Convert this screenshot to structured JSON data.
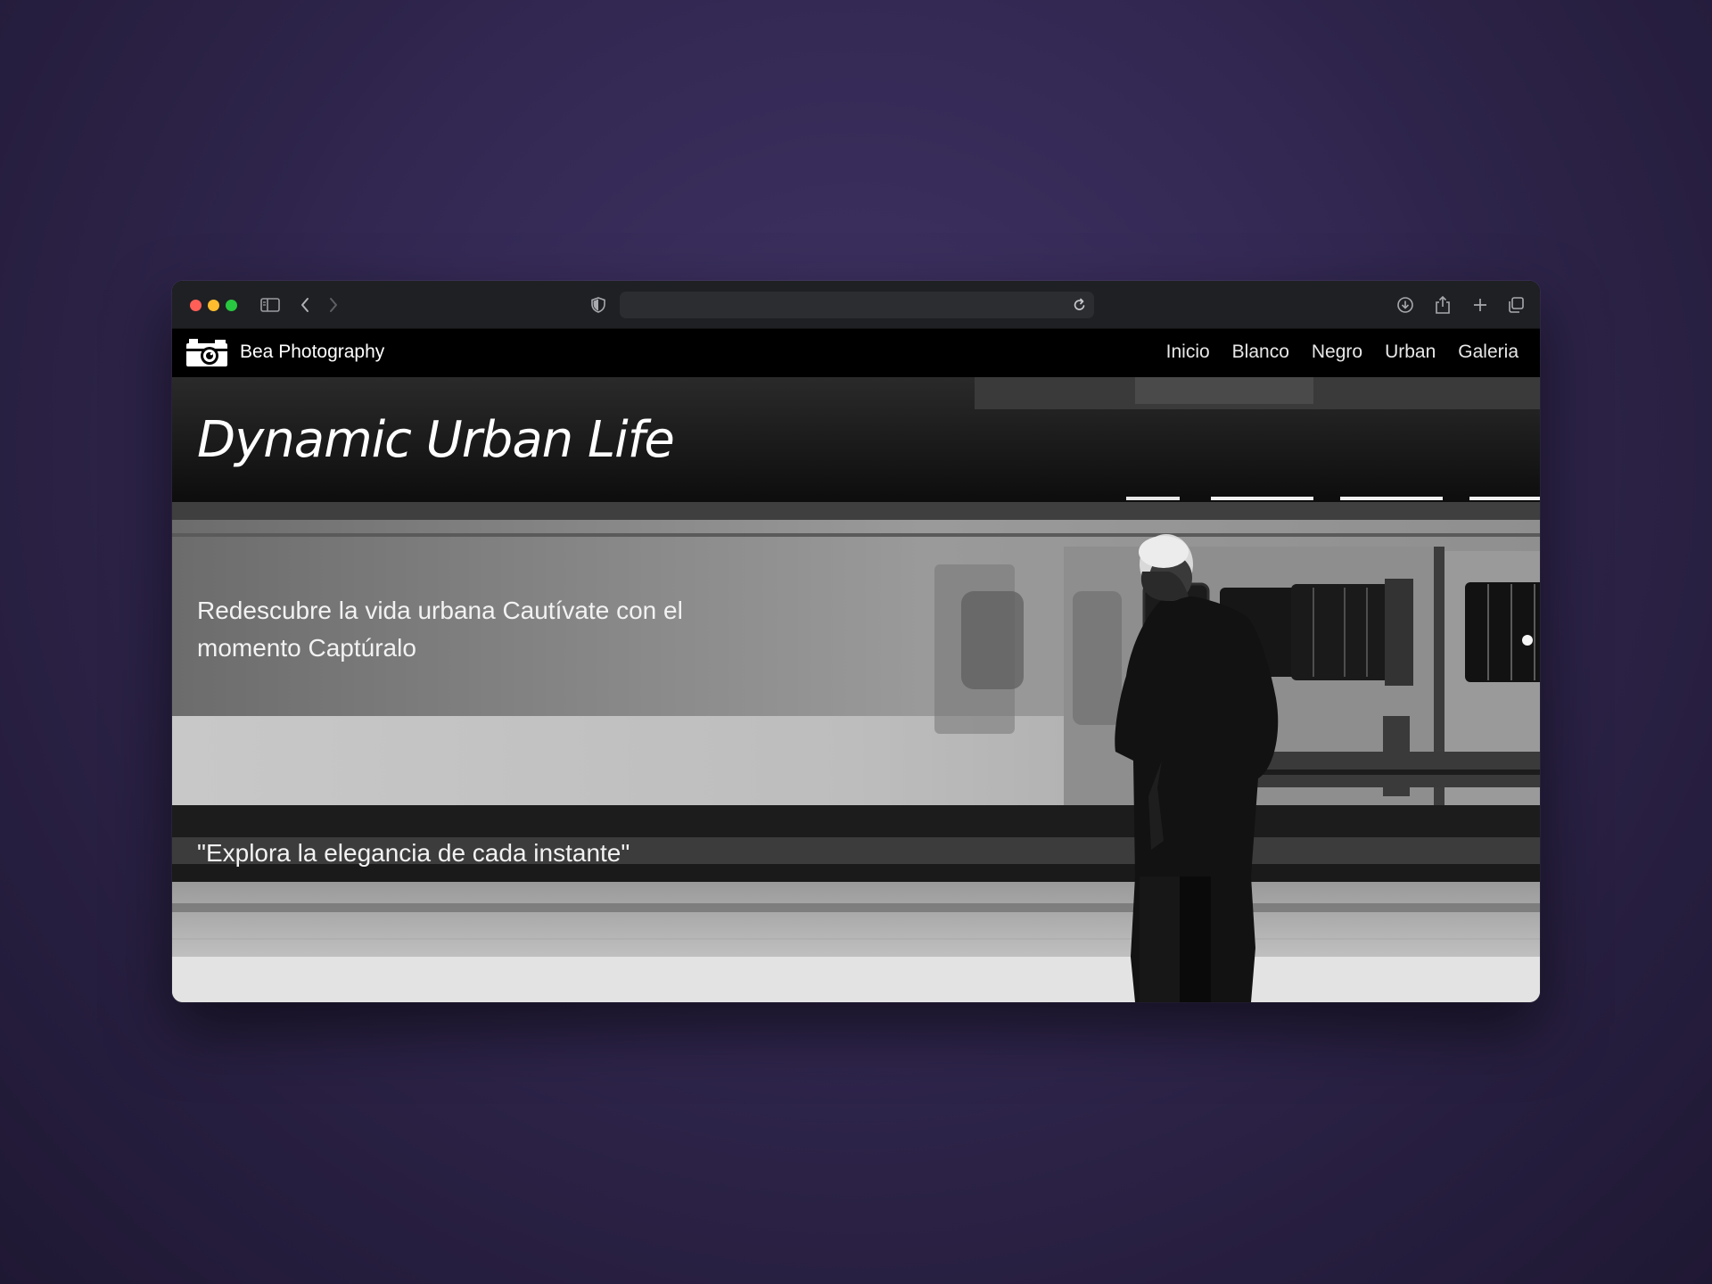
{
  "browser": {
    "address_text": "",
    "icons": [
      "sidebar-toggle-icon",
      "back-icon",
      "forward-icon",
      "shield-icon",
      "reload-icon",
      "download-icon",
      "share-icon",
      "new-tab-icon",
      "tabs-overview-icon"
    ]
  },
  "site": {
    "brand": "Bea Photography",
    "logo_icon": "camera-icon",
    "nav": [
      "Inicio",
      "Blanco",
      "Negro",
      "Urban",
      "Galeria"
    ]
  },
  "hero": {
    "title": "Dynamic Urban Life",
    "subtitle": "Redescubre la vida urbana Cautívate con el momento Captúralo",
    "quote": "\"Explora la elegancia de cada instante\""
  },
  "colors": {
    "desktop_background": "#352a56",
    "titlebar": "#1f2023",
    "navbar": "#000000",
    "traffic_red": "#ff5f57",
    "traffic_yellow": "#febc2e",
    "traffic_green": "#28c840"
  }
}
